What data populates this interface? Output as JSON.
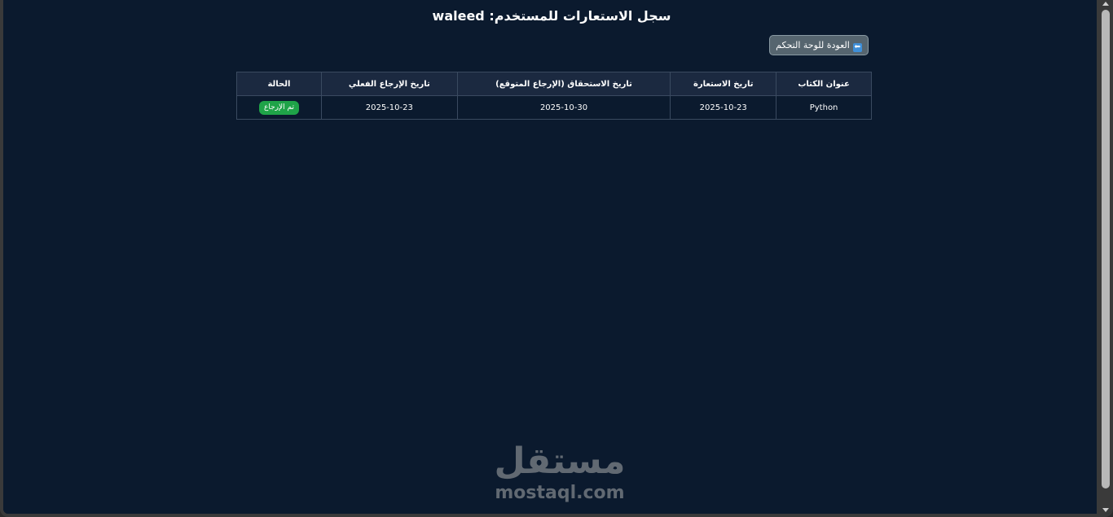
{
  "page": {
    "title": "سجل الاستعارات للمستخدم: waleed"
  },
  "toolbar": {
    "back_label": "العودة للوحة التحكم",
    "back_icon": "arrow-back-icon",
    "back_icon_glyph": "⬅"
  },
  "table": {
    "headers": [
      "عنوان الكتاب",
      "تاريخ الاستعارة",
      "تاريخ الاستحقاق (الإرجاع المتوقع)",
      "تاريخ الإرجاع الفعلي",
      "الحالة"
    ],
    "rows": [
      {
        "title": "Python",
        "borrow_date": "2025-10-23",
        "due_date": "2025-10-30",
        "return_date": "2025-10-23",
        "status": "تم الإرجاع"
      }
    ]
  },
  "watermark": {
    "arabic": "مستقل",
    "latin": "mostaql.com"
  },
  "colors": {
    "background": "#0b1a2e",
    "status_returned": "#1fa348",
    "button": "#56656f"
  }
}
